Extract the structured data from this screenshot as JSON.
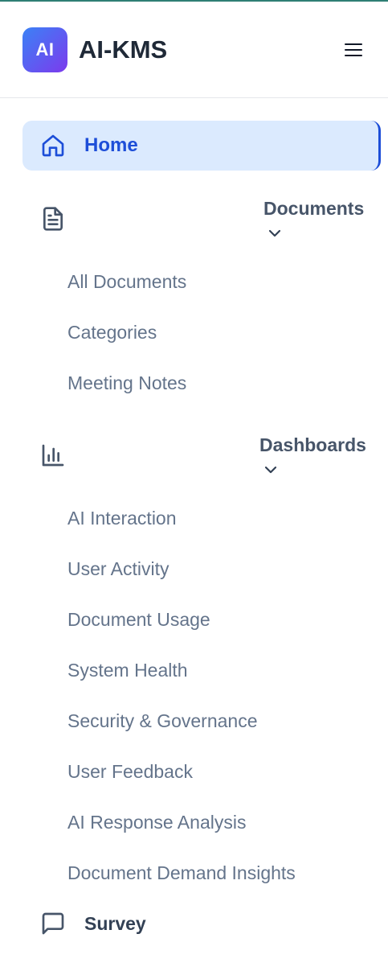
{
  "header": {
    "logo_text": "AI",
    "app_title": "AI-KMS",
    "menu_icon": "hamburger-menu-icon"
  },
  "nav": {
    "home": {
      "label": "Home",
      "icon": "home-icon",
      "active": true
    },
    "documents": {
      "label": "Documents",
      "icon": "document-icon",
      "expanded": true,
      "items": [
        "All Documents",
        "Categories",
        "Meeting Notes"
      ]
    },
    "dashboards": {
      "label": "Dashboards",
      "icon": "bar-chart-icon",
      "expanded": true,
      "items": [
        "AI Interaction",
        "User Activity",
        "Document Usage",
        "System Health",
        "Security & Governance",
        "User Feedback",
        "AI Response Analysis",
        "Document Demand Insights"
      ]
    },
    "survey": {
      "label": "Survey",
      "icon": "message-square-icon"
    }
  },
  "colors": {
    "accent": "#1d4ed8",
    "active_bg": "#dbeafe",
    "logo_gradient_start": "#3b82f6",
    "logo_gradient_end": "#7c3aed",
    "top_border": "#2f7f74"
  }
}
